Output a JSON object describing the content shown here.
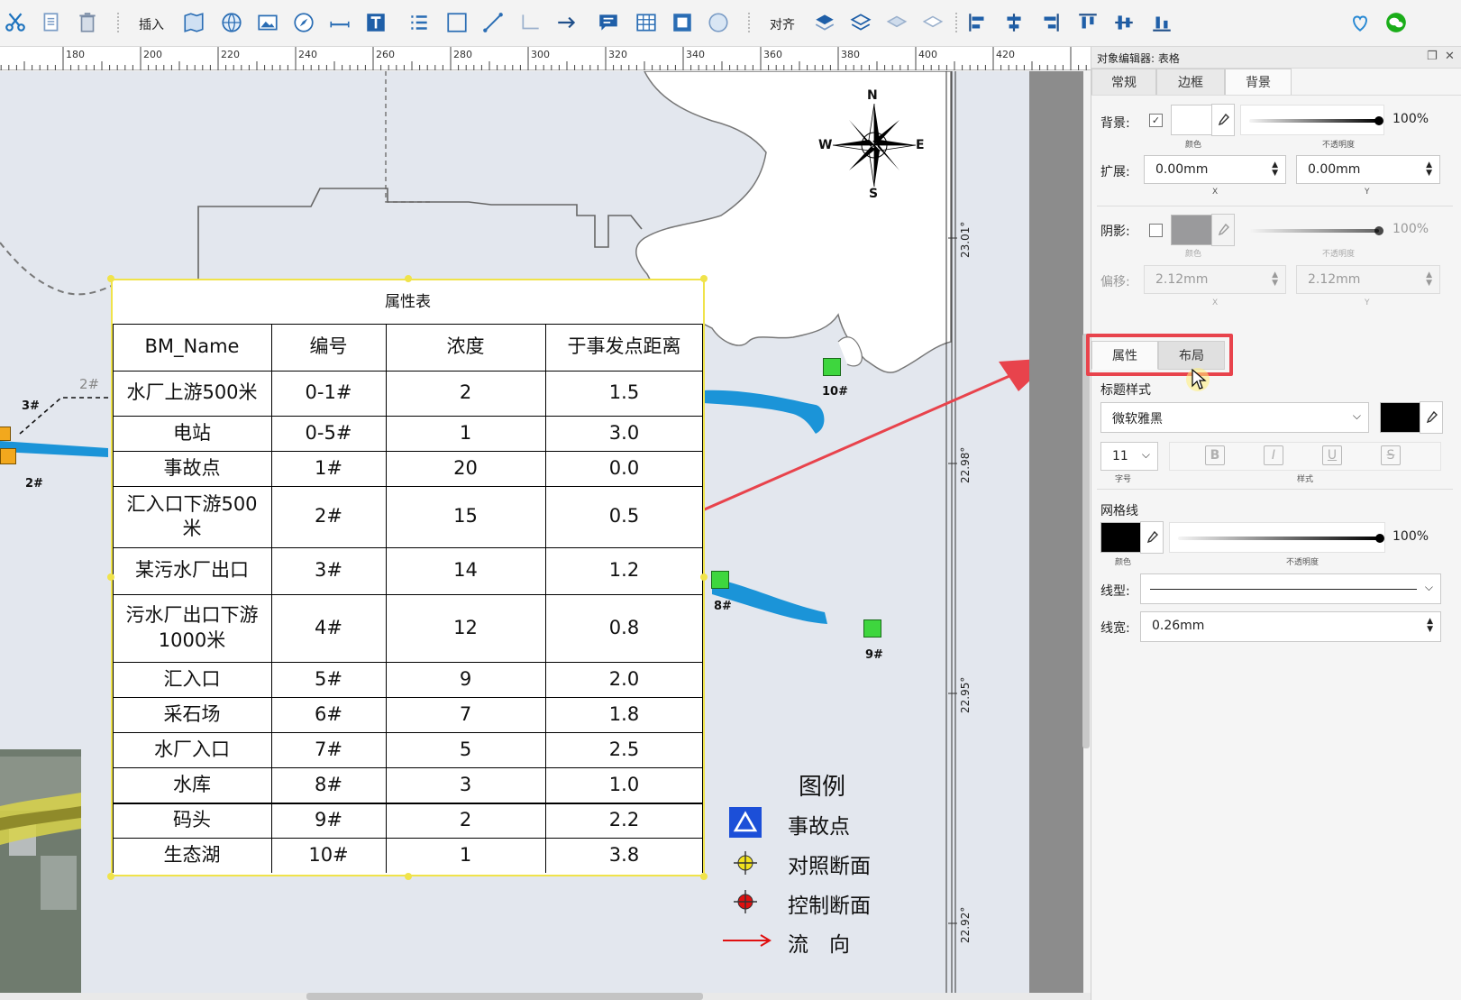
{
  "toolbar": {
    "insert_label": "插入",
    "align_label": "对齐"
  },
  "ruler": {
    "labels": [
      "180",
      "200",
      "220",
      "240",
      "260",
      "280",
      "300",
      "320",
      "340",
      "360",
      "380",
      "400",
      "420"
    ]
  },
  "map": {
    "compass": {
      "n": "N",
      "s": "S",
      "e": "E",
      "w": "W"
    },
    "latitudes": [
      "23.01°",
      "22.98°",
      "22.95°",
      "22.92°"
    ],
    "markers": {
      "m2_top": "2#",
      "m3": "3#",
      "m2": "2#",
      "m10": "10#",
      "m8": "8#",
      "m9": "9#"
    },
    "legend": {
      "title": "图例",
      "items": [
        "事故点",
        "对照断面",
        "控制断面",
        "流　向"
      ]
    }
  },
  "table": {
    "title": "属性表",
    "headers": [
      "BM_Name",
      "编号",
      "浓度",
      "于事发点距离"
    ],
    "rows": [
      [
        "水厂上游500米",
        "0-1#",
        "2",
        "1.5"
      ],
      [
        "电站",
        "0-5#",
        "1",
        "3.0"
      ],
      [
        "事故点",
        "1#",
        "20",
        "0.0"
      ],
      [
        "汇入口下游500米",
        "2#",
        "15",
        "0.5"
      ],
      [
        "某污水厂出口",
        "3#",
        "14",
        "1.2"
      ],
      [
        "污水厂出口下游1000米",
        "4#",
        "12",
        "0.8"
      ],
      [
        "汇入口",
        "5#",
        "9",
        "2.0"
      ],
      [
        "采石场",
        "6#",
        "7",
        "1.8"
      ],
      [
        "水厂入口",
        "7#",
        "5",
        "2.5"
      ],
      [
        "水库",
        "8#",
        "3",
        "1.0"
      ],
      [
        "码头",
        "9#",
        "2",
        "2.2"
      ],
      [
        "生态湖",
        "10#",
        "1",
        "3.8"
      ]
    ]
  },
  "panel": {
    "title": "对象编辑器: 表格",
    "tabs": [
      "常规",
      "边框",
      "背景"
    ],
    "background": {
      "label": "背景:",
      "color_caption": "颜色",
      "opacity_caption": "不透明度",
      "opacity": "100%",
      "opacity_value": 1.0
    },
    "extend": {
      "label": "扩展:",
      "x": "0.00mm",
      "y": "0.00mm",
      "x_caption": "X",
      "y_caption": "Y"
    },
    "shadow": {
      "label": "阴影:",
      "color_caption": "颜色",
      "opacity_caption": "不透明度",
      "opacity": "100%",
      "opacity_value": 1.0
    },
    "offset": {
      "label": "偏移:",
      "x": "2.12mm",
      "y": "2.12mm",
      "x_caption": "X",
      "y_caption": "Y"
    },
    "lower_tabs": [
      "属性",
      "布局"
    ],
    "title_style": {
      "label": "标题样式",
      "font": "微软雅黑",
      "size": "11",
      "size_caption": "字号",
      "style_caption": "样式",
      "style_buttons": [
        "B",
        "I",
        "U",
        "S"
      ]
    },
    "grid": {
      "label": "网格线",
      "color_caption": "颜色",
      "opacity_caption": "不透明度",
      "opacity": "100%",
      "opacity_value": 1.0,
      "line_type_label": "线型:",
      "line_width_label": "线宽:",
      "line_width": "0.26mm"
    },
    "colors": {
      "highlight": "#e8434c",
      "accent": "#0a63b8"
    }
  }
}
